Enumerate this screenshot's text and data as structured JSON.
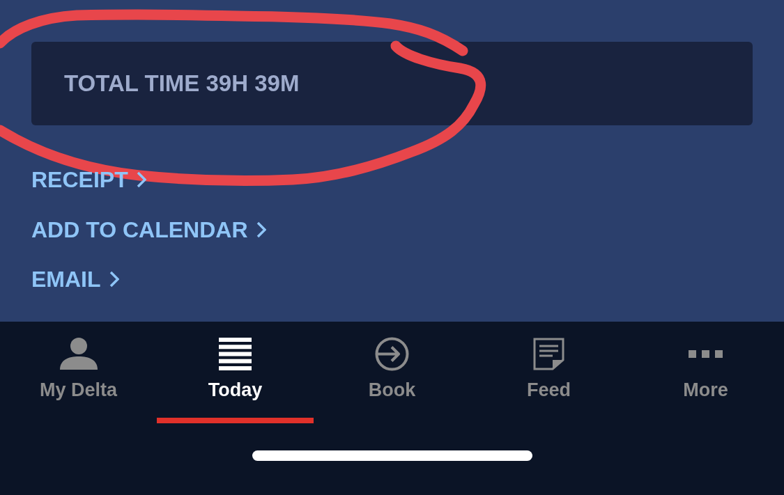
{
  "summary_card": {
    "text": "TOTAL TIME 39H 39M"
  },
  "links": [
    {
      "label": "RECEIPT"
    },
    {
      "label": "ADD TO CALENDAR"
    },
    {
      "label": "EMAIL"
    }
  ],
  "tab_bar": {
    "tabs": [
      {
        "label": "My Delta",
        "selected": false
      },
      {
        "label": "Today",
        "selected": true
      },
      {
        "label": "Book",
        "selected": false
      },
      {
        "label": "Feed",
        "selected": false
      },
      {
        "label": "More",
        "selected": false
      }
    ]
  }
}
